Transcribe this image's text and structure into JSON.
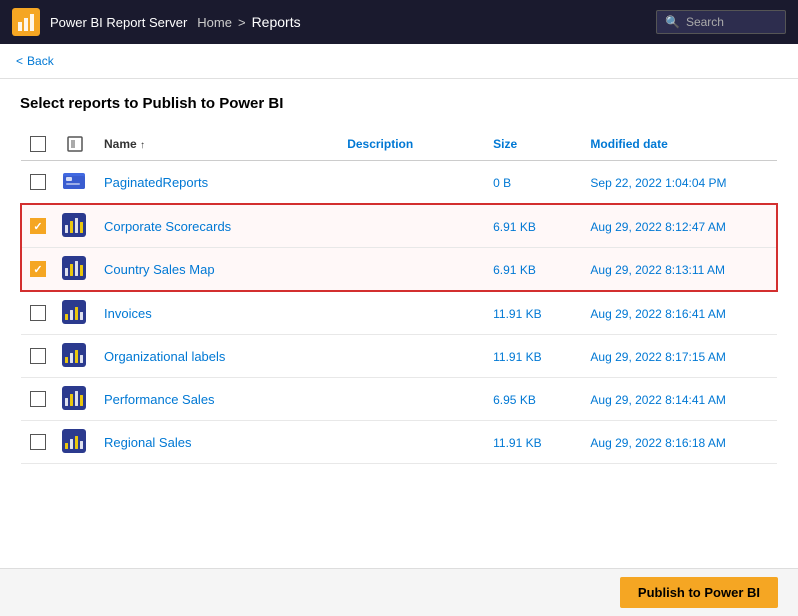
{
  "header": {
    "app_name": "Power BI Report Server",
    "breadcrumb": {
      "home": "Home",
      "separator": ">",
      "current": "Reports"
    },
    "search_placeholder": "Search"
  },
  "back_label": "Back",
  "page_title": "Select reports to Publish to Power BI",
  "table": {
    "columns": {
      "name": "Name",
      "description": "Description",
      "size": "Size",
      "modified": "Modified date"
    },
    "rows": [
      {
        "id": "paginated-reports",
        "name": "PaginatedReports",
        "description": "",
        "size": "0 B",
        "modified": "Sep 22, 2022 1:04:04 PM",
        "checked": false,
        "icon": "folder",
        "highlighted": false
      },
      {
        "id": "corporate-scorecards",
        "name": "Corporate Scorecards",
        "description": "",
        "size": "6.91 KB",
        "modified": "Aug 29, 2022 8:12:47 AM",
        "checked": true,
        "icon": "report",
        "highlighted": true
      },
      {
        "id": "country-sales-map",
        "name": "Country Sales Map",
        "description": "",
        "size": "6.91 KB",
        "modified": "Aug 29, 2022 8:13:11 AM",
        "checked": true,
        "icon": "report",
        "highlighted": true
      },
      {
        "id": "invoices",
        "name": "Invoices",
        "description": "",
        "size": "11.91 KB",
        "modified": "Aug 29, 2022 8:16:41 AM",
        "checked": false,
        "icon": "kpi",
        "highlighted": false
      },
      {
        "id": "organizational-labels",
        "name": "Organizational labels",
        "description": "",
        "size": "11.91 KB",
        "modified": "Aug 29, 2022 8:17:15 AM",
        "checked": false,
        "icon": "kpi",
        "highlighted": false
      },
      {
        "id": "performance-sales",
        "name": "Performance Sales",
        "description": "",
        "size": "6.95 KB",
        "modified": "Aug 29, 2022 8:14:41 AM",
        "checked": false,
        "icon": "report",
        "highlighted": false
      },
      {
        "id": "regional-sales",
        "name": "Regional Sales",
        "description": "",
        "size": "11.91 KB",
        "modified": "Aug 29, 2022 8:16:18 AM",
        "checked": false,
        "icon": "kpi",
        "highlighted": false
      }
    ]
  },
  "footer": {
    "publish_button": "Publish to Power BI"
  }
}
